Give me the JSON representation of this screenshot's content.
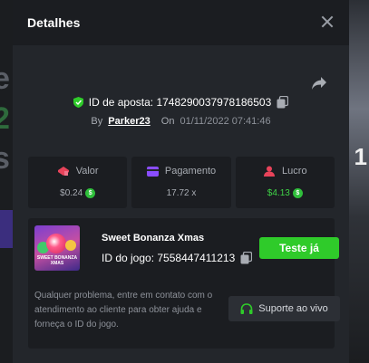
{
  "modal": {
    "title": "Detalhes",
    "bet_id_label": "ID de aposta: 1748290037978186503",
    "by_label": "By",
    "username": "Parker23",
    "on_label": "On",
    "date": "01/11/2022 07:41:46"
  },
  "stats": [
    {
      "label": "Valor",
      "value": "$0.24",
      "icon": "wager-icon",
      "has_coin": true
    },
    {
      "label": "Pagamento",
      "value": "17.72 x",
      "icon": "payout-card-icon",
      "has_coin": false
    },
    {
      "label": "Lucro",
      "value": "$4.13",
      "icon": "profit-icon",
      "has_coin": true
    }
  ],
  "game": {
    "name": "Sweet Bonanza Xmas",
    "thumb_text": "SWEET BONANZA XMAS",
    "id_label": "ID do jogo: 7558447411213",
    "try_button": "Teste já",
    "help_text": "Qualquer problema, entre em contato com o atendimento ao cliente para obter ajuda e forneça o ID do jogo.",
    "support_button": "Suporte ao vivo"
  },
  "background": {
    "left_chars": [
      "e",
      "2",
      "s"
    ],
    "right_chars": [
      "1"
    ]
  },
  "colors": {
    "accent_green": "#2fcb2a",
    "profit_green": "#3fd447",
    "wager_red": "#e8435a",
    "payout_purple": "#8a4dff",
    "profit_red": "#e8435a"
  }
}
